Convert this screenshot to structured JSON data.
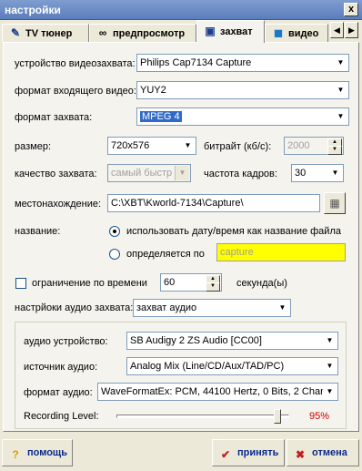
{
  "window": {
    "title": "настройки",
    "close_glyph": "x"
  },
  "tabs": [
    {
      "label": "TV тюнер",
      "icon": "tv-tuner-icon"
    },
    {
      "label": "предпросмотр",
      "icon": "glasses-icon"
    },
    {
      "label": "захват",
      "icon": "capture-icon",
      "active": true
    },
    {
      "label": "видео",
      "icon": "video-icon"
    }
  ],
  "capture": {
    "device_label": "устройство видеозахвата:",
    "device_value": "Philips Cap7134 Capture",
    "input_format_label": "формат входящего видео:",
    "input_format_value": "YUY2",
    "capture_format_label": "формат захвата:",
    "capture_format_value": "MPEG 4",
    "size_label": "размер:",
    "size_value": "720x576",
    "bitrate_label": "битрайт (кб/с):",
    "bitrate_value": "2000",
    "quality_label": "качество захвата:",
    "quality_value": "самый быстр",
    "framerate_label": "частота кадров:",
    "framerate_value": "30",
    "location_label": "местонахождение:",
    "location_value": "C:\\XBT\\Kworld-7134\\Capture\\",
    "name_label": "название:",
    "name_option_datetime": "использовать дату/время как название файла",
    "name_option_custom": "определяется по",
    "name_custom_value": "capture",
    "time_limit_label": "ограничение по времени",
    "time_limit_value": "60",
    "time_limit_unit": "секунда(ы)",
    "audio_settings_label": "настрйоки аудио захвата:",
    "audio_settings_value": "захват аудио"
  },
  "audio": {
    "device_label": "аудио устройство:",
    "device_value": "SB Audigy 2 ZS Audio [CC00]",
    "source_label": "источник аудио:",
    "source_value": "Analog Mix (Line/CD/Aux/TAD/PC)",
    "format_label": "формат аудио:",
    "format_value": "WaveFormatEx: PCM, 44100 Hertz, 0 Bits, 2 Chanr",
    "level_label": "Recording Level:",
    "level_text": "95%",
    "level_fraction": 0.95
  },
  "buttons": {
    "help": "помощь",
    "apply": "принять",
    "cancel": "отмена"
  },
  "colors": {
    "accent_selection": "#316ac5",
    "highlight_field": "#ffff00",
    "level_text": "#cc0000",
    "bottom_button_text": "#0b2a8c"
  }
}
